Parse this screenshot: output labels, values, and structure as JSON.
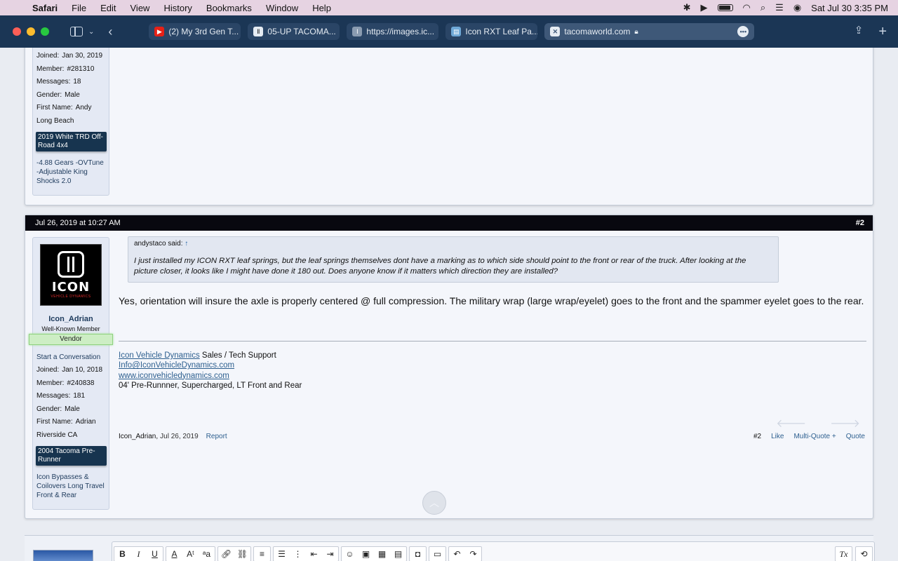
{
  "menubar": {
    "app": "Safari",
    "items": [
      "File",
      "Edit",
      "View",
      "History",
      "Bookmarks",
      "Window",
      "Help"
    ],
    "datetime": "Sat Jul 30  3:35 PM"
  },
  "browser": {
    "tabs": [
      {
        "label": "(2) My 3rd Gen T...",
        "icon": "youtube-icon"
      },
      {
        "label": "05-UP TACOMA...",
        "icon": "site-icon"
      },
      {
        "label": "https://images.ic...",
        "icon": "site-icon"
      },
      {
        "label": "Icon RXT Leaf Pa...",
        "icon": "image-icon"
      }
    ],
    "address": "tacomaworld.com",
    "accent": "#1b3655"
  },
  "post1": {
    "stats": [
      {
        "k": "Joined:",
        "v": "Jan 30, 2019"
      },
      {
        "k": "Member:",
        "v": "#281310"
      },
      {
        "k": "Messages:",
        "v": "18"
      },
      {
        "k": "Gender:",
        "v": "Male"
      },
      {
        "k": "First Name:",
        "v": "Andy"
      },
      {
        "k": "",
        "v": "Long Beach"
      }
    ],
    "truck": "2019 White TRD Off-Road 4x4",
    "mods": "-4.88 Gears -OVTune -Adjustable King Shocks 2.0"
  },
  "post2": {
    "date": "Jul 26, 2019 at 10:27 AM",
    "number": "#2",
    "user": {
      "logo_word": "ICON",
      "logo_sub": "VEHICLE DYNAMICS",
      "name": "Icon_Adrian",
      "title": "Well-Known Member",
      "badge": "Vendor",
      "start_convo": "Start a Conversation",
      "stats": [
        {
          "k": "Joined:",
          "v": "Jan 10, 2018"
        },
        {
          "k": "Member:",
          "v": "#240838"
        },
        {
          "k": "Messages:",
          "v": "181"
        },
        {
          "k": "Gender:",
          "v": "Male"
        },
        {
          "k": "First Name:",
          "v": "Adrian"
        },
        {
          "k": "",
          "v": "Riverside CA"
        }
      ],
      "truck": "2004 Tacoma Pre-Runner",
      "mods": "Icon Bypasses & Coilovers Long Travel Front & Rear"
    },
    "quote": {
      "author": "andystaco said:",
      "arrow": "↑",
      "text": "I just installed my ICON RXT leaf springs, but the leaf springs themselves dont have a marking as to which side should point to the front or rear of the truck. After looking at the picture closer, it looks like I might have done it 180 out. Does anyone know if it matters which direction they are installed?"
    },
    "body": "Yes, orientation will insure the axle is properly centered @ full compression. The military wrap (large wrap/eyelet) goes to the front and the spammer eyelet goes to the rear.",
    "signature": {
      "company_link": "Icon Vehicle Dynamics",
      "company_role": " Sales / Tech Support",
      "email": "Info@IconVehicleDynamics.com",
      "website": "www.iconvehicledynamics.com",
      "vehicle": "04' Pre-Runnner, Supercharged, LT Front and Rear"
    },
    "footer": {
      "author": "Icon_Adrian,",
      "date": "Jul 26, 2019",
      "report": "Report",
      "number": "#2",
      "like": "Like",
      "multiquote": "Multi-Quote +",
      "quote": "Quote"
    }
  }
}
